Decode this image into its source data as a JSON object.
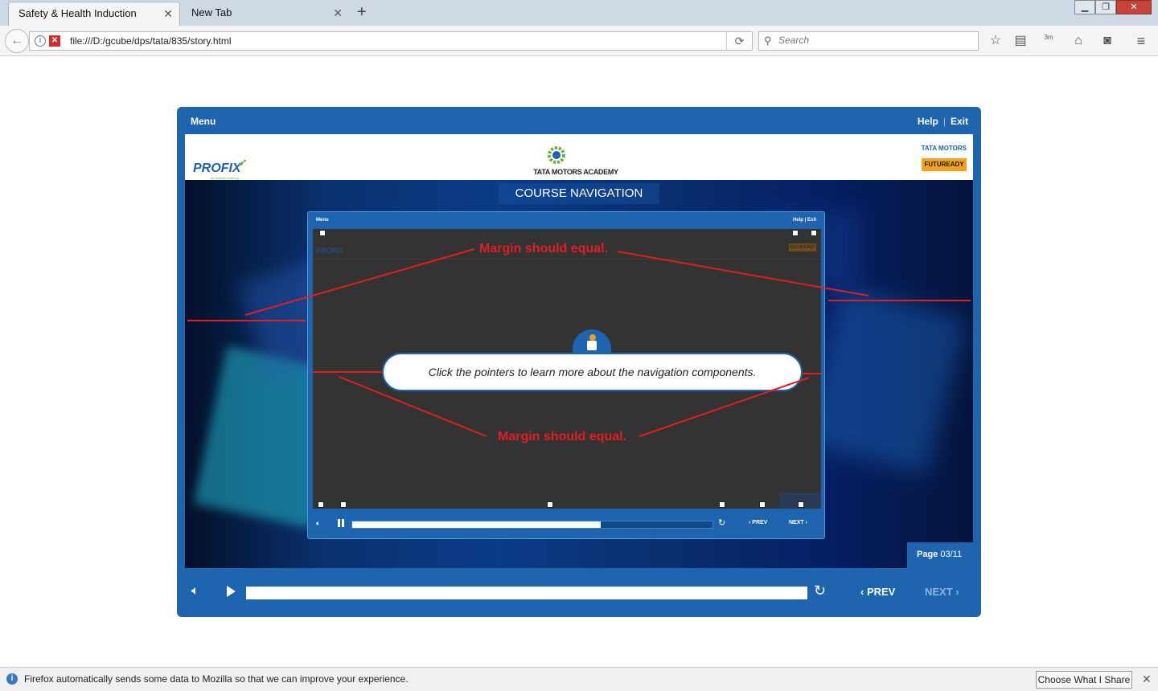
{
  "browser": {
    "tabs": [
      {
        "label": "Safety & Health Induction"
      },
      {
        "label": "New Tab"
      }
    ],
    "tab_close": "✕",
    "new_tab": "+",
    "window": {
      "minimize": "▁",
      "maximize": "❐",
      "close": "✕"
    },
    "url": "file:///D:/gcube/dps/tata/835/story.html",
    "search_placeholder": "Search",
    "toolbar_icons": [
      "back-icon",
      "reload-icon",
      "bookmark-star-icon",
      "reading-list-icon",
      "download-icon",
      "home-icon",
      "pocket-icon",
      "hamburger-menu-icon"
    ],
    "download_badge": "3m"
  },
  "course": {
    "menu_label": "Menu",
    "help_label": "Help",
    "exit_label": "Exit",
    "logos": {
      "profix": "PROFIX",
      "profix_tagline": "for smarter learning",
      "academy": "TATA MOTORS ACADEMY",
      "tata_motors": "TATA MOTORS",
      "futuready": "FUTUREADY"
    },
    "stage_title": "COURSE NAVIGATION",
    "page_label": "Page",
    "page_value": "03/11",
    "controls": {
      "prev": "PREV",
      "next": "NEXT",
      "progress": 1.0
    }
  },
  "inner_player": {
    "menu_label": "Menu",
    "help_label": "Help",
    "exit_label": "Exit",
    "profix": "PROFIX",
    "futuready": "FUTUREADY",
    "prev": "PREV",
    "next": "NEXT",
    "progress": 0.69,
    "instruction": "Click the pointers to learn more about the navigation components."
  },
  "annotations": {
    "top": "Margin should equal.",
    "bottom": "Margin should equal."
  },
  "notification": {
    "text": "Firefox automatically sends some data to Mozilla so that we can improve your experience.",
    "button": "Choose What I Share",
    "close": "✕"
  },
  "colors": {
    "brand_blue": "#1e64ae",
    "annotation_red": "#e31d24",
    "futuready_orange": "#f2a21e"
  }
}
